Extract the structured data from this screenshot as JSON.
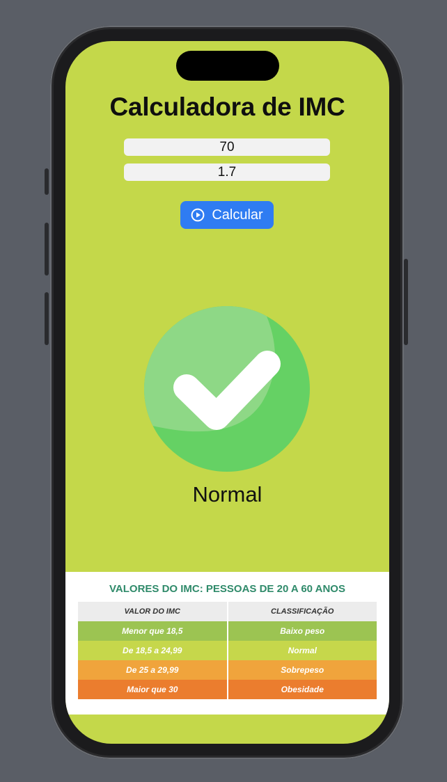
{
  "app": {
    "title": "Calculadora de IMC"
  },
  "inputs": {
    "weight": "70",
    "height": "1.7"
  },
  "button": {
    "label": "Calcular",
    "icon": "play-circle-icon"
  },
  "result": {
    "status": "Normal",
    "icon": "check-circle-icon"
  },
  "table": {
    "title": "VALORES DO IMC: PESSOAS DE 20 A 60 ANOS",
    "headers": [
      "VALOR DO IMC",
      "CLASSIFICAÇÃO"
    ],
    "rows": [
      {
        "value": "Menor que 18,5",
        "class": "Baixo peso",
        "color": "#9cc452"
      },
      {
        "value": "De 18,5 a 24,99",
        "class": "Normal",
        "color": "#c6d74b"
      },
      {
        "value": "De 25 a 29,99",
        "class": "Sobrepeso",
        "color": "#f0a43c"
      },
      {
        "value": "Maior que 30",
        "class": "Obesidade",
        "color": "#eb7d2e"
      }
    ]
  },
  "colors": {
    "background": "#c4d84a",
    "button": "#2f7cf2",
    "check": "#65d164"
  }
}
